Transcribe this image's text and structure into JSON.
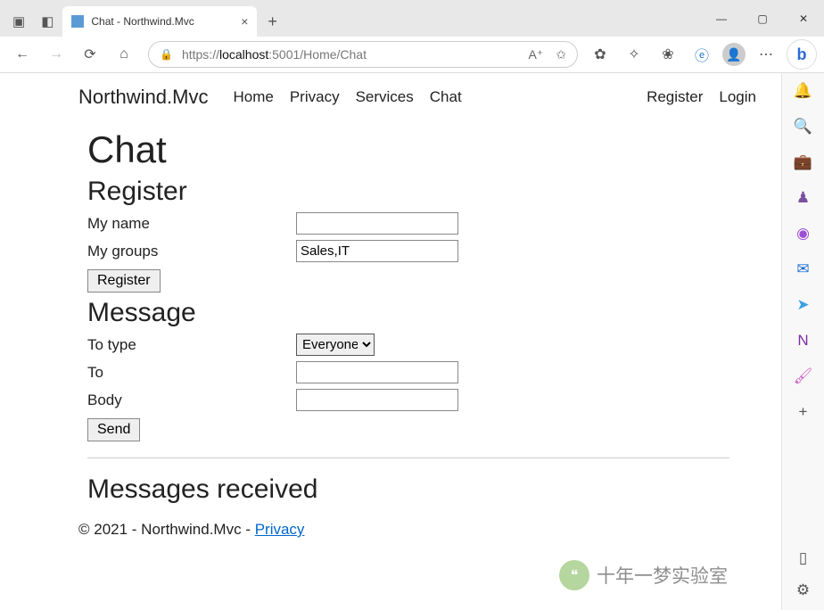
{
  "browser": {
    "tab_title": "Chat - Northwind.Mvc",
    "url_prefix": "https://",
    "url_host": "localhost",
    "url_path": ":5001/Home/Chat"
  },
  "nav": {
    "brand": "Northwind.Mvc",
    "links": [
      "Home",
      "Privacy",
      "Services",
      "Chat"
    ],
    "right": [
      "Register",
      "Login"
    ]
  },
  "page": {
    "title": "Chat",
    "register_heading": "Register",
    "register_fields": {
      "name_label": "My name",
      "name_value": "",
      "groups_label": "My groups",
      "groups_value": "Sales,IT"
    },
    "register_button": "Register",
    "message_heading": "Message",
    "message_fields": {
      "totype_label": "To type",
      "totype_value": "Everyone",
      "to_label": "To",
      "to_value": "",
      "body_label": "Body",
      "body_value": ""
    },
    "send_button": "Send",
    "received_heading": "Messages received"
  },
  "footer": {
    "copyright": "© 2021 - Northwind.Mvc - ",
    "privacy": "Privacy"
  },
  "watermark": "十年一梦实验室"
}
